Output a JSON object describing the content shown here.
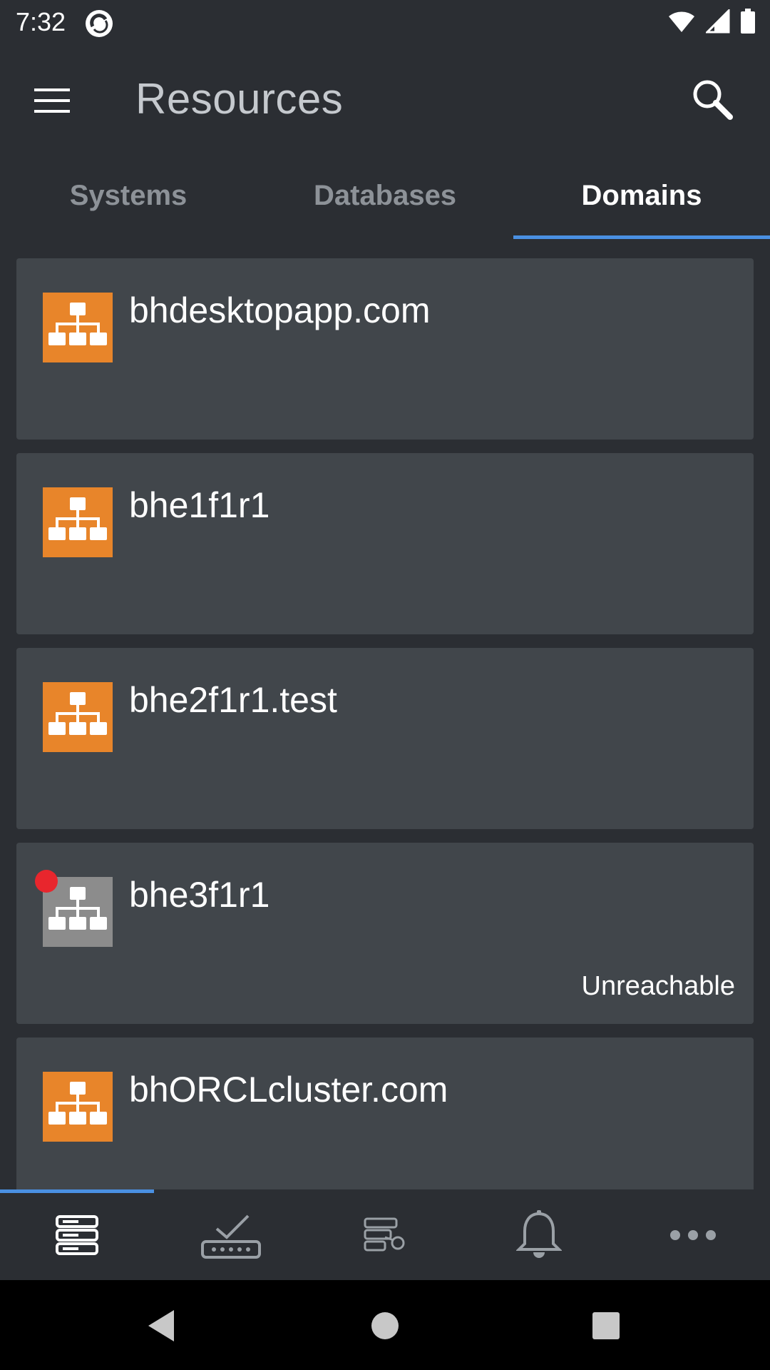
{
  "status_bar": {
    "time": "7:32",
    "icons": [
      "app-notification-icon",
      "wifi-icon",
      "cellular-signal-icon",
      "battery-icon"
    ]
  },
  "header": {
    "title": "Resources",
    "menu_icon": "hamburger-menu-icon",
    "search_icon": "search-icon"
  },
  "tabs": [
    {
      "label": "Systems",
      "active": false
    },
    {
      "label": "Databases",
      "active": false
    },
    {
      "label": "Domains",
      "active": true
    }
  ],
  "domains": [
    {
      "name": "bhdesktopapp.com",
      "status": "",
      "icon": "domain-hierarchy-icon"
    },
    {
      "name": "bhe1f1r1",
      "status": "",
      "icon": "domain-hierarchy-icon"
    },
    {
      "name": "bhe2f1r1.test",
      "status": "",
      "icon": "domain-hierarchy-icon"
    },
    {
      "name": "bhe3f1r1",
      "status": "Unreachable",
      "icon": "domain-hierarchy-icon"
    },
    {
      "name": "bhORCLcluster.com",
      "status": "",
      "icon": "domain-hierarchy-icon"
    }
  ],
  "bottom_nav": [
    {
      "icon": "server-stack-icon",
      "active": true
    },
    {
      "icon": "approval-check-icon",
      "active": false
    },
    {
      "icon": "credentials-key-icon",
      "active": false
    },
    {
      "icon": "notification-bell-icon",
      "active": false
    },
    {
      "icon": "more-options-icon",
      "active": false
    }
  ],
  "system_nav": [
    "back-icon",
    "home-icon",
    "recents-icon"
  ],
  "colors": {
    "background": "#2b2e33",
    "card": "#41464b",
    "accent": "#4a90e2",
    "domain_icon_ok": "#e8852a",
    "domain_icon_unreachable": "#8c8c8c",
    "error_dot": "#e8262d"
  }
}
